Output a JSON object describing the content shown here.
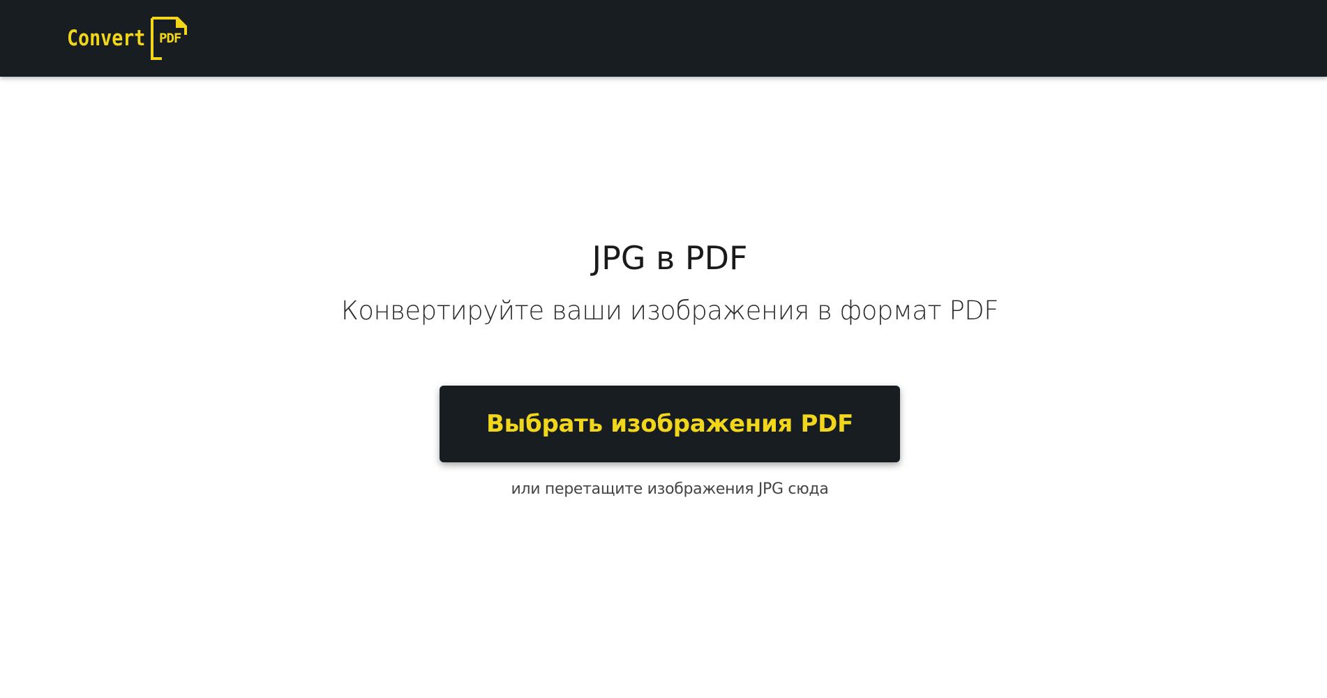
{
  "header": {
    "logo_text": "Convert",
    "logo_badge": "PDF",
    "background_color": "#171d21",
    "accent_color": "#f2d61c"
  },
  "main": {
    "title": "JPG в PDF",
    "subtitle": "Конвертируйте ваши изображения в формат PDF",
    "upload_button_label": "Выбрать изображения PDF",
    "drop_hint": "или перетащите изображения JPG сюда"
  }
}
